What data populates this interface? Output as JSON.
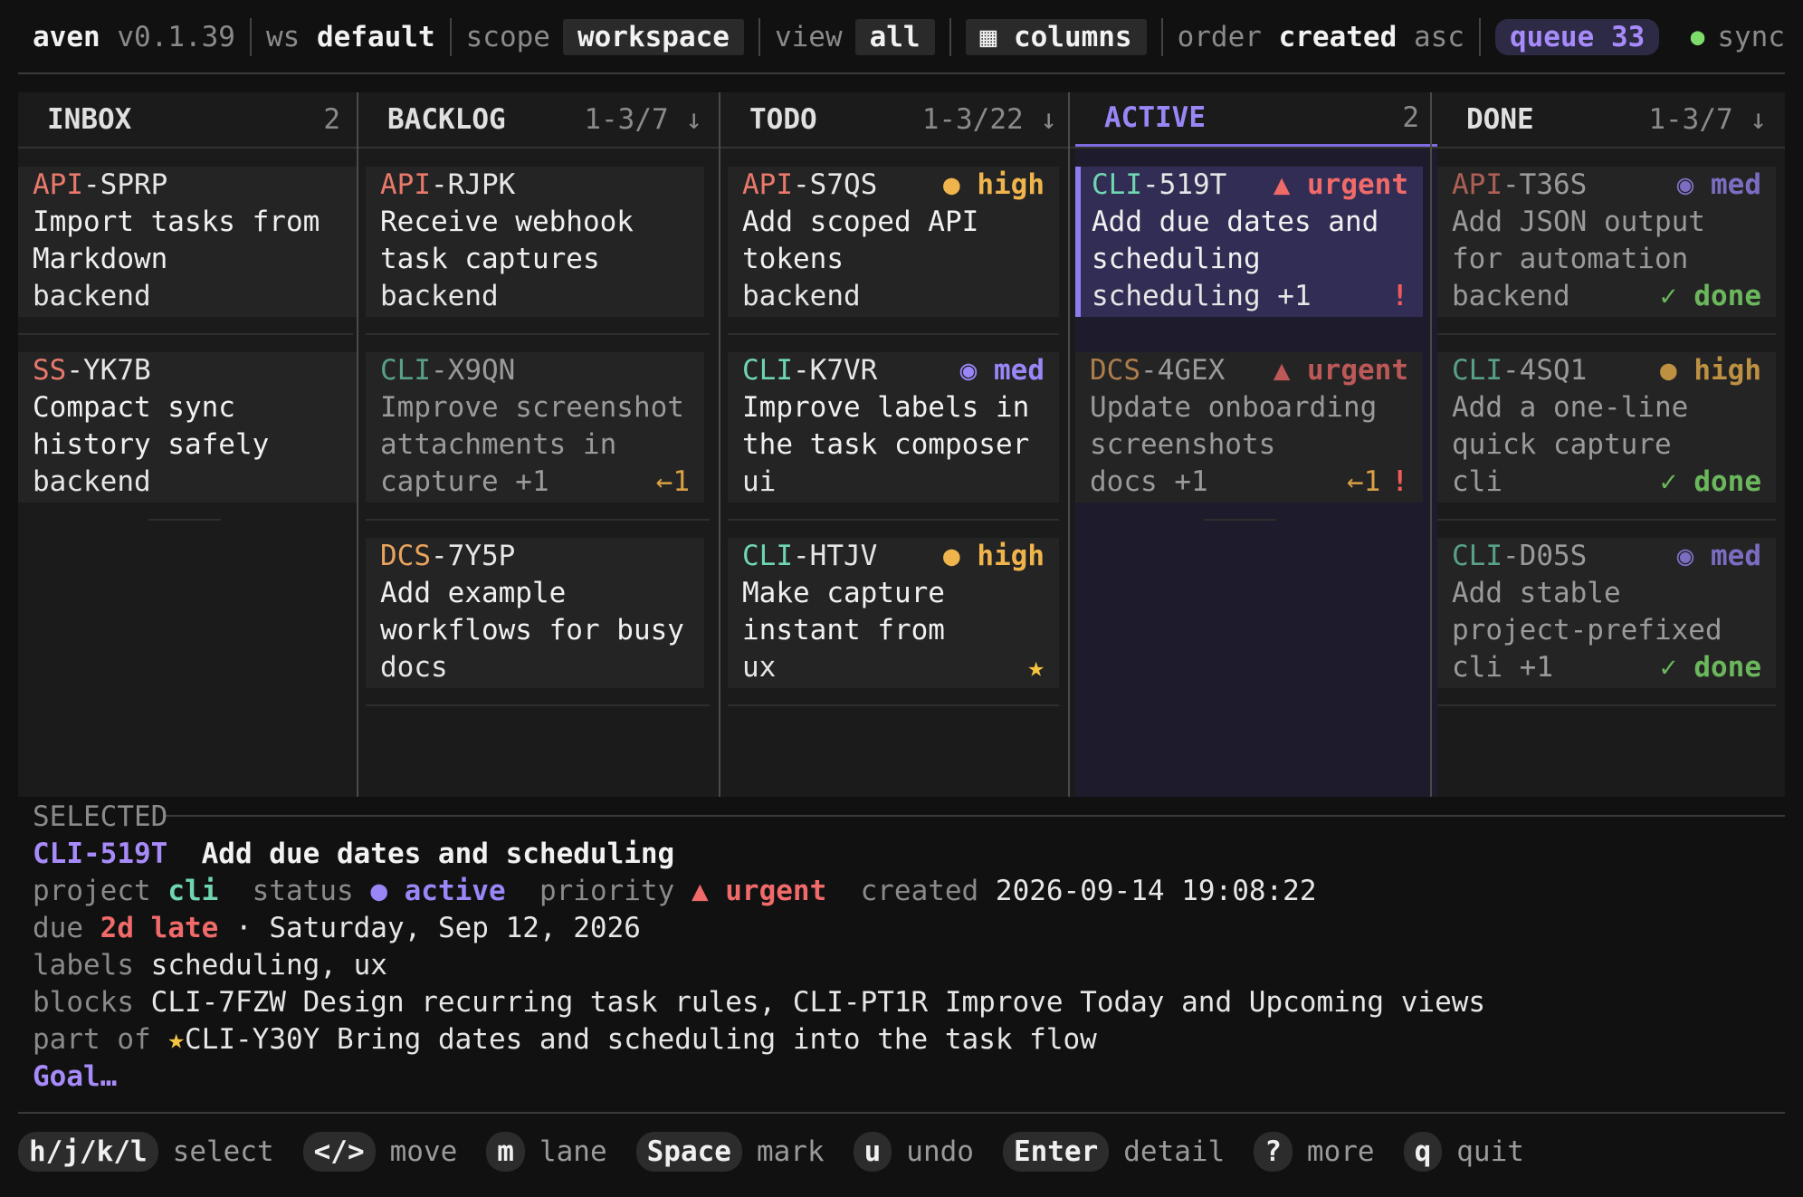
{
  "topbar": {
    "app": "aven",
    "version": "v0.1.39",
    "ws_label": "ws",
    "ws_value": "default",
    "scope_label": "scope",
    "scope_value": "workspace",
    "view_label": "view",
    "view_value": "all",
    "columns_label": "columns",
    "order_label": "order",
    "order_value": "created",
    "order_dir": "asc",
    "queue_label": "queue",
    "queue_count": "33",
    "sync_label": "sync"
  },
  "columns": [
    {
      "name": "INBOX",
      "count": "2"
    },
    {
      "name": "BACKLOG",
      "count": "1-3/7 ↓"
    },
    {
      "name": "TODO",
      "count": "1-3/22 ↓"
    },
    {
      "name": "ACTIVE",
      "count": "2"
    },
    {
      "name": "DONE",
      "count": "1-3/7 ↓"
    }
  ],
  "cards": {
    "inbox": [
      {
        "prefix": "API",
        "id": "-SPRP",
        "title": "Import tasks from Markdown checklists",
        "label": "backend"
      },
      {
        "prefix": "SS",
        "id": "-YK7B",
        "title": "Compact sync history safely",
        "label": "backend"
      }
    ],
    "backlog": [
      {
        "prefix": "API",
        "id": "-RJPK",
        "title": "Receive webhook task captures",
        "label": "backend"
      },
      {
        "prefix": "CLI",
        "id": "-X9QN",
        "title": "Improve screenshot attachments in task …",
        "label": "capture +1",
        "mark": "←1"
      },
      {
        "prefix": "DCS",
        "id": "-7Y5P",
        "title": "Add example workflows for busy projects",
        "label": "docs"
      }
    ],
    "todo": [
      {
        "prefix": "API",
        "id": "-S7QS",
        "priority": "● high",
        "title": "Add scoped API tokens",
        "label": "backend"
      },
      {
        "prefix": "CLI",
        "id": "-K7VR",
        "priority": "◉ med",
        "title": "Improve labels in the task composer",
        "label": "ui"
      },
      {
        "prefix": "CLI",
        "id": "-HTJV",
        "priority": "● high",
        "title": "Make capture instant from anywhere",
        "label": "ux",
        "mark": "★"
      }
    ],
    "active": [
      {
        "prefix": "CLI",
        "id": "-519T",
        "priority": "▲ urgent",
        "title": "Add due dates and scheduling",
        "label": "scheduling +1",
        "mark": "!"
      },
      {
        "prefix": "DCS",
        "id": "-4GEX",
        "priority": "▲ urgent",
        "title": "Update onboarding screenshots",
        "label": "docs +1",
        "mark": "←1",
        "mark2": "!"
      }
    ],
    "done": [
      {
        "prefix": "API",
        "id": "-T36S",
        "priority": "◉ med",
        "title": "Add JSON output for automation",
        "label": "backend",
        "mark": "✓ done"
      },
      {
        "prefix": "CLI",
        "id": "-4SQ1",
        "priority": "● high",
        "title": "Add a one-line quick capture command",
        "label": "cli",
        "mark": "✓ done"
      },
      {
        "prefix": "CLI",
        "id": "-D05S",
        "priority": "◉ med",
        "title": "Add stable project-prefixed tas…",
        "label": "cli +1",
        "mark": "✓ done"
      }
    ]
  },
  "selected": {
    "header": "SELECTED",
    "id": "CLI-519T",
    "title": "Add due dates and scheduling",
    "project_label": "project",
    "project": "cli",
    "status_label": "status",
    "status": "● active",
    "priority_label": "priority",
    "priority": "▲ urgent",
    "created_label": "created",
    "created": "2026-09-14 19:08:22",
    "due_label": "due",
    "due_late": "2d late",
    "due_date": "· Saturday, Sep 12, 2026",
    "labels_label": "labels",
    "labels": "scheduling, ux",
    "blocks_label": "blocks",
    "blocks": "CLI-7FZW Design recurring task rules, CLI-PT1R Improve Today and Upcoming views",
    "part_of_label": "part of",
    "part_of_star": "★",
    "part_of": "CLI-Y30Y Bring dates and scheduling into the task flow",
    "goal": "Goal…"
  },
  "footer": [
    {
      "key": "h/j/k/l",
      "desc": "select"
    },
    {
      "key": "</>",
      "desc": "move"
    },
    {
      "key": "m",
      "desc": "lane"
    },
    {
      "key": "Space",
      "desc": "mark"
    },
    {
      "key": "u",
      "desc": "undo"
    },
    {
      "key": "Enter",
      "desc": "detail"
    },
    {
      "key": "?",
      "desc": "more"
    },
    {
      "key": "q",
      "desc": "quit"
    }
  ],
  "colors": {
    "accent": "#9a86f7",
    "urgent": "#f06a6a",
    "high": "#f0b44c",
    "done": "#7ddc6a"
  }
}
